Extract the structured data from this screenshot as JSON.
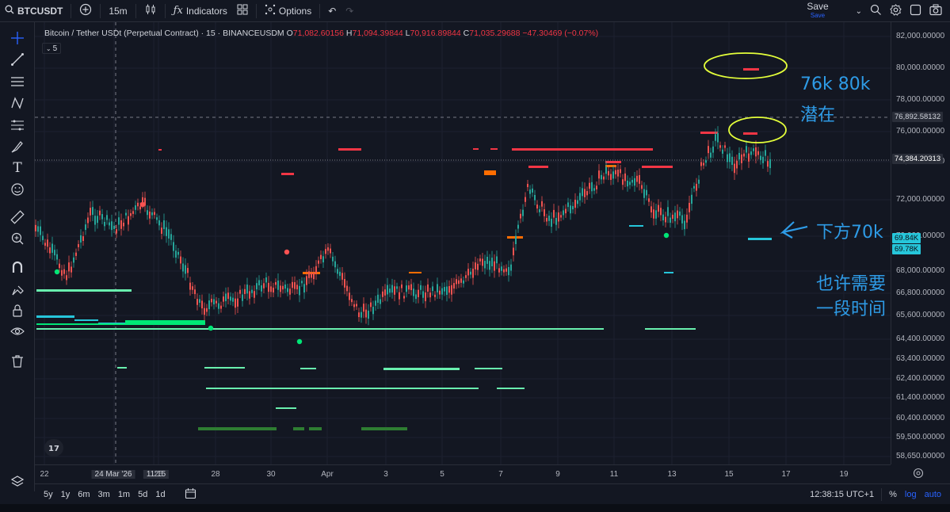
{
  "topbar": {
    "symbol": "BTCUSDT",
    "interval": "15m",
    "indicators_label": "Indicators",
    "options_label": "Options",
    "save_label": "Save",
    "save_sub": "Save"
  },
  "legend": {
    "title": "Bitcoin / Tether USDt (Perpetual Contract) · 15 · BINANCEUSDM",
    "o_key": "O",
    "o_val": "71,082.60156",
    "h_key": "H",
    "h_val": "71,094.39844",
    "l_key": "L",
    "l_val": "70,916.89844",
    "c_key": "C",
    "c_val": "71,035.29688",
    "change": "−47.30469 (−0.07%)",
    "indicator_count": "5"
  },
  "price_axis": {
    "ticks": [
      "82,000.00000",
      "80,000.00000",
      "78,000.00000",
      "76,000.00000",
      "74,000.00000",
      "72,000.00000",
      "70,000.00000",
      "68,000.00000",
      "66,800.00000",
      "65,600.00000",
      "64,400.00000",
      "63,400.00000",
      "62,400.00000",
      "61,400.00000",
      "60,400.00000",
      "59,500.00000",
      "58,650.00000"
    ],
    "crosshair_price": "76,892.58132",
    "last_price": "74,384.20313",
    "tag1": "69.84K",
    "tag2": "69.78K"
  },
  "time_axis": {
    "labels": [
      "22",
      "24 Mar '26",
      "11:15",
      "26",
      "28",
      "30",
      "Apr",
      "3",
      "5",
      "7",
      "9",
      "11",
      "13",
      "15",
      "17",
      "19"
    ]
  },
  "bottombar": {
    "ranges": [
      "5y",
      "1y",
      "6m",
      "3m",
      "1m",
      "5d",
      "1d"
    ],
    "clock": "12:38:15 UTC+1",
    "pct": "%",
    "log": "log",
    "auto": "auto"
  },
  "annotations": {
    "a1": "76k  80k",
    "a2": "潜在",
    "a3": "下方70k",
    "a4": "也许需要",
    "a5": "一段时间"
  },
  "colors": {
    "background": "#131722",
    "red": "#f23645",
    "green": "#26a69a",
    "bright_green": "#00e676",
    "cyan": "#26c6da",
    "orange": "#ff6d00",
    "annotation_blue": "#2e9be6",
    "annotation_yellow": "#e4ff3a"
  }
}
